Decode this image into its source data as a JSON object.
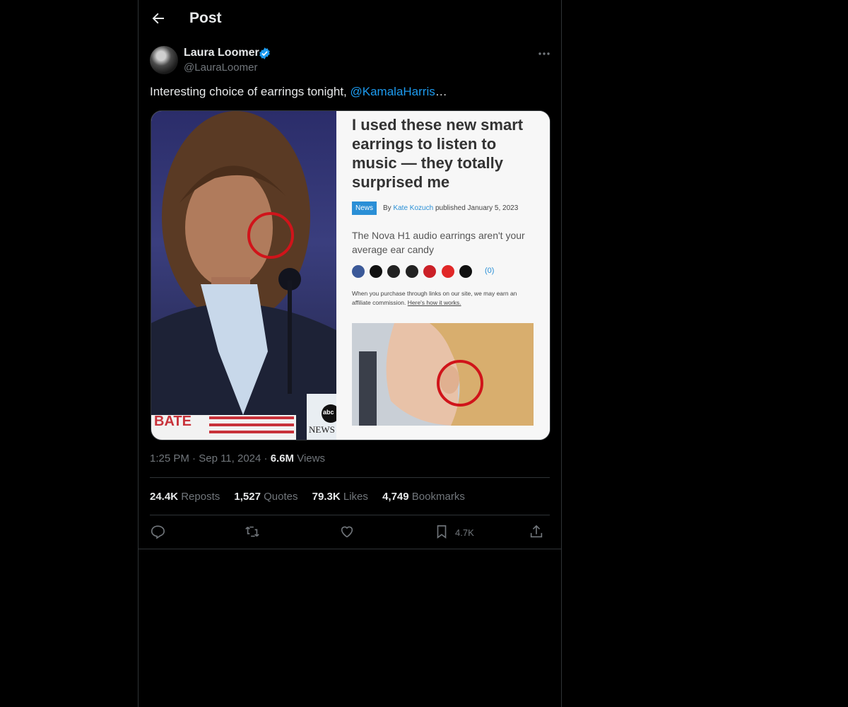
{
  "header": {
    "title": "Post"
  },
  "author": {
    "name": "Laura Loomer",
    "handle": "@LauraLoomer"
  },
  "tweet": {
    "text_before": "Interesting choice of earrings tonight, ",
    "mention": "@KamalaHarris",
    "text_after": "…"
  },
  "media": {
    "left_photo": {
      "banner_text": "BATE",
      "network_logo": "abc",
      "network_text": "NEWS"
    },
    "article": {
      "headline": "I used these new smart earrings to listen to music — they totally surprised me",
      "tag": "News",
      "by": "By",
      "author": "Kate Kozuch",
      "published": "published January 5, 2023",
      "subhead": "The Nova H1 audio earrings aren't your average ear candy",
      "comments": "(0)",
      "disclaimer": "When you purchase through links on our site, we may earn an affiliate commission.",
      "disclaimer_link": "Here's how it works."
    }
  },
  "meta": {
    "time": "1:25 PM",
    "sep": "·",
    "date": "Sep 11, 2024",
    "views_count": "6.6M",
    "views_label": "Views"
  },
  "stats": {
    "reposts_count": "24.4K",
    "reposts_label": "Reposts",
    "quotes_count": "1,527",
    "quotes_label": "Quotes",
    "likes_count": "79.3K",
    "likes_label": "Likes",
    "bookmarks_count": "4,749",
    "bookmarks_label": "Bookmarks"
  },
  "actions": {
    "bookmark_count": "4.7K"
  },
  "colors": {
    "background": "#000000",
    "accent": "#1d9bf0",
    "muted": "#71767b",
    "border": "#2f3336",
    "text": "#e7e9ea"
  },
  "icons": [
    "back-arrow-icon",
    "verified-badge-icon",
    "more-icon",
    "reply-icon",
    "repost-icon",
    "like-icon",
    "bookmark-icon",
    "share-icon"
  ]
}
